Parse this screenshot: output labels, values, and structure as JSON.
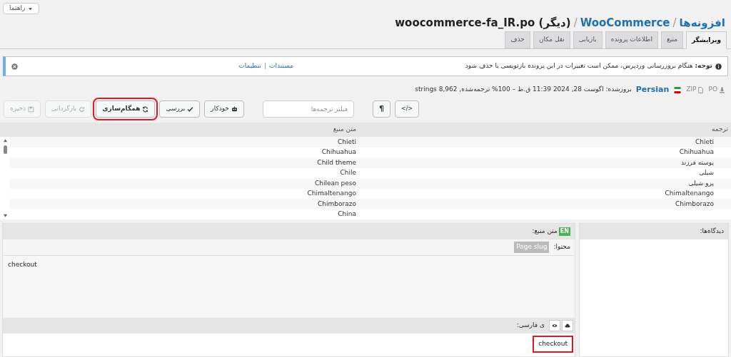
{
  "help_button": "راهنما",
  "breadcrumb": {
    "root": "افزونه‌ها",
    "plugin": "WooCommerce",
    "file": "woocommerce-fa_IR.po (دیگر)",
    "separators": [
      "/",
      "/"
    ]
  },
  "tabs": [
    {
      "label": "ویرایشگر",
      "selected": true
    },
    {
      "label": "منبع",
      "selected": false
    },
    {
      "label": "اطلاعات پرونده",
      "selected": false
    },
    {
      "label": "بازیابی",
      "selected": false
    },
    {
      "label": "نقل مکان",
      "selected": false
    },
    {
      "label": "حذف",
      "selected": false
    }
  ],
  "notice": {
    "label": "توجه:",
    "text": "هنگام بروزرسانی وردپرس، ممکن است تغییرات در این پرونده بازنویسی یا حذف شود",
    "links": [
      "مستندات",
      "تنظیمات"
    ],
    "separator": "|"
  },
  "file_info": {
    "downloads": [
      "PO",
      "ZIP"
    ],
    "language": "Persian",
    "details": "بروزشده: اگوست 28, 2024 11:39 ق.ظ – 100% ترجمه‌شده, 8,962 strings"
  },
  "toolbar": {
    "buttons": [
      {
        "kind": "code",
        "label": "</>",
        "disabled": false,
        "highlighted": false
      },
      {
        "kind": "pilcrow",
        "label": "¶",
        "disabled": false,
        "highlighted": false
      },
      {
        "kind": "filter",
        "placeholder": "فیلتر ترجمه‌ها"
      },
      {
        "kind": "auto",
        "label": "خودکار",
        "disabled": false,
        "highlighted": false
      },
      {
        "kind": "check",
        "label": "بررسی",
        "disabled": false,
        "highlighted": false
      },
      {
        "kind": "sync",
        "label": "همگام‌سازی",
        "disabled": false,
        "highlighted": true
      },
      {
        "kind": "revert",
        "label": "بازگردانی",
        "disabled": true,
        "highlighted": false
      },
      {
        "kind": "save",
        "label": "ذخیره",
        "disabled": true,
        "highlighted": false
      }
    ]
  },
  "table": {
    "columns": [
      "ترجمه",
      "متن منبع"
    ],
    "rows": [
      {
        "source": "Chieti",
        "translation": "Chieti"
      },
      {
        "source": "Chihuahua",
        "translation": "Chihuahua"
      },
      {
        "source": "Child theme",
        "translation": "پوسته فرزند"
      },
      {
        "source": "Chile",
        "translation": "شیلی"
      },
      {
        "source": "Chilean peso",
        "translation": "پزو شیلی"
      },
      {
        "source": "Chimaltenango",
        "translation": "Chimaltenango"
      },
      {
        "source": "Chimborazo",
        "translation": "Chimborazo"
      },
      {
        "source": "China"
      }
    ]
  },
  "source_panel": {
    "label": "متن منبع:",
    "badge": "EN",
    "context_label": "محتوا:",
    "context_tag": "Page slug",
    "text": "checkout"
  },
  "translation_panel": {
    "label": "ی فارسی:",
    "value": "checkout",
    "highlighted": true
  },
  "comments_panel": {
    "label": "دیدگاه‌ها:"
  }
}
